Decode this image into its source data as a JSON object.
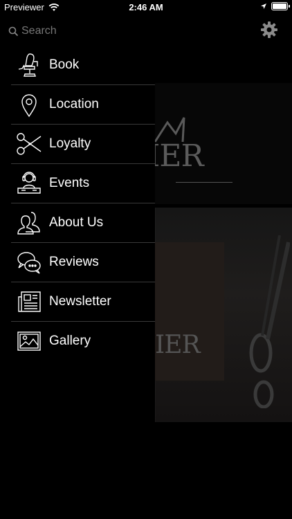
{
  "status_bar": {
    "carrier": "Previewer",
    "time": "2:46 AM"
  },
  "search": {
    "placeholder": "Search"
  },
  "menu": [
    {
      "label": "Book",
      "icon": "barber-chair-icon"
    },
    {
      "label": "Location",
      "icon": "map-pin-icon"
    },
    {
      "label": "Loyalty",
      "icon": "scissors-icon"
    },
    {
      "label": "Events",
      "icon": "dj-icon"
    },
    {
      "label": "About Us",
      "icon": "people-icon"
    },
    {
      "label": "Reviews",
      "icon": "chat-bubbles-icon"
    },
    {
      "label": "Newsletter",
      "icon": "newspaper-icon"
    },
    {
      "label": "Gallery",
      "icon": "picture-icon"
    }
  ],
  "background": {
    "logo_text": "IER",
    "card_text": "IER"
  }
}
